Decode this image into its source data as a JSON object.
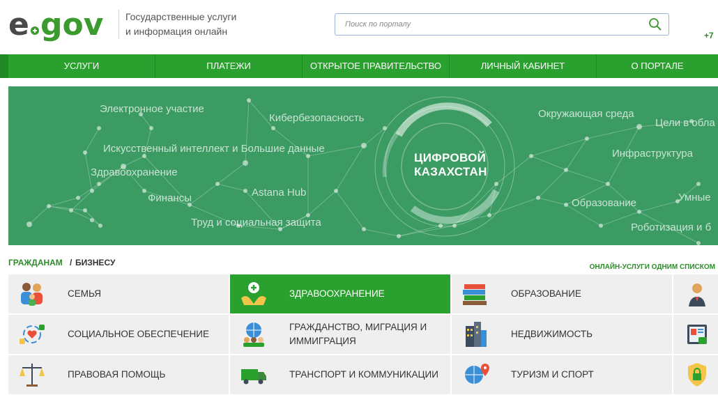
{
  "header": {
    "logo_text": "e.gov",
    "tagline_line1": "Государственные услуги",
    "tagline_line2": "и информация онлайн",
    "search_placeholder": "Поиск по порталу",
    "phone": "+7"
  },
  "nav": {
    "items": [
      {
        "label": "УСЛУГИ"
      },
      {
        "label": "ПЛАТЕЖИ"
      },
      {
        "label": "ОТКРЫТОЕ ПРАВИТЕЛЬСТВО"
      },
      {
        "label": "ЛИЧНЫЙ КАБИНЕТ"
      },
      {
        "label": "О ПОРТАЛЕ"
      }
    ]
  },
  "banner": {
    "center_line1": "ЦИФРОВОЙ",
    "center_line2": "КАЗАХСТАН",
    "words": [
      "Электронное участие",
      "Кибербезопасность",
      "Искусственный интеллект и Большие данные",
      "Здравоохранение",
      "Финансы",
      "Astana Hub",
      "Труд и социальная защита",
      "Окружающая среда",
      "Цели в обла",
      "Инфраструктура",
      "Образование",
      "Умные",
      "Роботизация и б"
    ]
  },
  "categories": {
    "tab_citizens": "ГРАЖДАНАМ",
    "separator": "/",
    "tab_business": "БИЗНЕСУ",
    "all_services_link": "ОНЛАЙН-УСЛУГИ ОДНИМ СПИСКОМ",
    "tiles": [
      {
        "label": "СЕМЬЯ",
        "icon": "family-icon"
      },
      {
        "label": "ЗДРАВООХРАНЕНИЕ",
        "icon": "healthcare-icon",
        "active": true
      },
      {
        "label": "ОБРАЗОВАНИЕ",
        "icon": "books-icon"
      },
      {
        "label": "",
        "icon": "person-icon"
      },
      {
        "label": "СОЦИАЛЬНОЕ ОБЕСПЕЧЕНИЕ",
        "icon": "social-care-icon"
      },
      {
        "label": "ГРАЖДАНСТВО, МИГРАЦИЯ И ИММИГРАЦИЯ",
        "icon": "globe-people-icon"
      },
      {
        "label": "НЕДВИЖИМОСТЬ",
        "icon": "buildings-icon"
      },
      {
        "label": "",
        "icon": "id-card-icon"
      },
      {
        "label": "ПРАВОВАЯ ПОМОЩЬ",
        "icon": "scales-icon"
      },
      {
        "label": "ТРАНСПОРТ И КОММУНИКАЦИИ",
        "icon": "truck-icon"
      },
      {
        "label": "ТУРИЗМ И СПОРТ",
        "icon": "globe-pin-icon"
      },
      {
        "label": "",
        "icon": "shield-lock-icon"
      }
    ]
  },
  "colors": {
    "brand_green": "#2aa12e",
    "banner_green": "#3c9b63",
    "tile_bg": "#efefef"
  }
}
